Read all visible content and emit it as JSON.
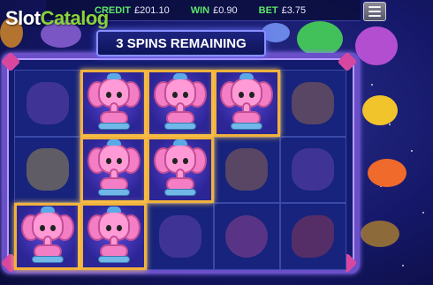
{
  "top_bar": {
    "credit_label": "CREDIT",
    "credit_value": "£201.10",
    "win_label": "WIN",
    "win_value": "£0.90",
    "bet_label": "BET",
    "bet_value": "£3.75"
  },
  "menu": {
    "icon": "hamburger-menu-icon"
  },
  "watermark": {
    "part1": "Slot",
    "part2": "Catalog"
  },
  "banner": {
    "text": "3 SPINS REMAINING"
  },
  "reels": {
    "columns": 5,
    "rows": 3,
    "cells": [
      [
        "dragon",
        "elephant",
        "elephant",
        "elephant",
        "lion"
      ],
      [
        "duck",
        "elephant",
        "elephant",
        "lion",
        "dragon"
      ],
      [
        "elephant",
        "elephant",
        "dragon",
        "heart",
        "rocket"
      ]
    ],
    "winning": [
      [
        false,
        true,
        true,
        true,
        false
      ],
      [
        false,
        true,
        true,
        false,
        false
      ],
      [
        true,
        true,
        false,
        false,
        false
      ]
    ]
  },
  "colors": {
    "frame": "#6a4fc9",
    "win_border": "#f1b23c",
    "background": "#15186a",
    "label_green": "#5de86a"
  }
}
